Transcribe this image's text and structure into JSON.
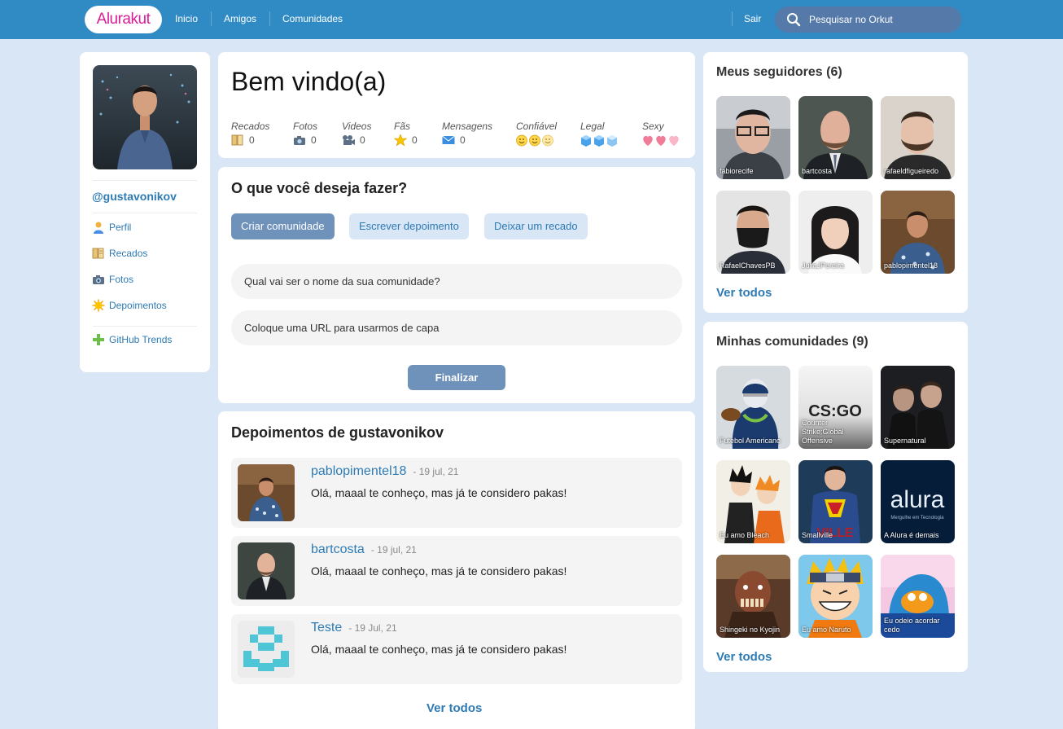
{
  "header": {
    "logo": "Alurakut",
    "nav": [
      "Inicio",
      "Amigos",
      "Comunidades"
    ],
    "logout": "Sair",
    "search_placeholder": "Pesquisar no Orkut"
  },
  "profile": {
    "username": "@gustavonikov",
    "menu": [
      {
        "label": "Perfil",
        "icon": "user-icon"
      },
      {
        "label": "Recados",
        "icon": "notebook-icon"
      },
      {
        "label": "Fotos",
        "icon": "camera-icon"
      },
      {
        "label": "Depoimentos",
        "icon": "sun-icon"
      }
    ],
    "extra_menu": {
      "label": "GitHub Trends",
      "icon": "plus-icon"
    }
  },
  "welcome": {
    "title": "Bem vindo(a)",
    "stats": [
      {
        "label": "Recados",
        "value": "0",
        "icon": "notebook-icon"
      },
      {
        "label": "Fotos",
        "value": "0",
        "icon": "camera-icon"
      },
      {
        "label": "Videos",
        "value": "0",
        "icon": "video-camera-icon"
      },
      {
        "label": "Fãs",
        "value": "0",
        "icon": "star-icon"
      },
      {
        "label": "Mensagens",
        "value": "0",
        "icon": "envelope-icon"
      }
    ],
    "ratings": [
      {
        "label": "Confiável",
        "icon": "smiley-icon"
      },
      {
        "label": "Legal",
        "icon": "ice-cube-icon"
      },
      {
        "label": "Sexy",
        "icon": "heart-icon"
      }
    ]
  },
  "form": {
    "title": "O que você deseja fazer?",
    "buttons": [
      "Criar comunidade",
      "Escrever depoimento",
      "Deixar um recado"
    ],
    "name_placeholder": "Qual vai ser o nome da sua comunidade?",
    "url_placeholder": "Coloque uma URL para usarmos de capa",
    "submit": "Finalizar"
  },
  "testimonials": {
    "title": "Depoimentos de gustavonikov",
    "items": [
      {
        "user": "pablopimentel18",
        "date": "- 19 jul, 21",
        "text": "Olá, maaal te conheço, mas já te considero pakas!"
      },
      {
        "user": "bartcosta",
        "date": "- 19 jul, 21",
        "text": "Olá, maaal te conheço, mas já te considero pakas!"
      },
      {
        "user": "Teste",
        "date": "- 19 Jul, 21",
        "text": "Olá, maaal te conheço, mas já te considero pakas!"
      }
    ],
    "see_all": "Ver todos"
  },
  "followers": {
    "title": "Meus seguidores (6)",
    "items": [
      "fabiorecife",
      "bartcosta",
      "rafaeldfigueiredo",
      "RafaelChavesPB",
      "JuliaJPereira",
      "pablopimentel18"
    ],
    "see_all": "Ver todos"
  },
  "communities": {
    "title": "Minhas comunidades (9)",
    "items": [
      "Futebol Americano",
      "Counter Strike:Global Offensive",
      "Supernatural",
      "Eu amo Bleach",
      "Smallville",
      "A Alura é demais",
      "Shingeki no Kyojin",
      "Eu amo Naruto",
      "Eu odeio acordar cedo"
    ],
    "logo_texts": {
      "csgo": "CS:GO",
      "alura": "alura",
      "alura_sub": "Mergulhe em Tecnologia",
      "smallville": "VILLE"
    },
    "see_all": "Ver todos"
  },
  "colors": {
    "topbar": "#308bc5",
    "background": "#d9e6f6",
    "link": "#2e7bb4",
    "logo_text": "#d81d99",
    "button_active": "#6f92bb"
  }
}
